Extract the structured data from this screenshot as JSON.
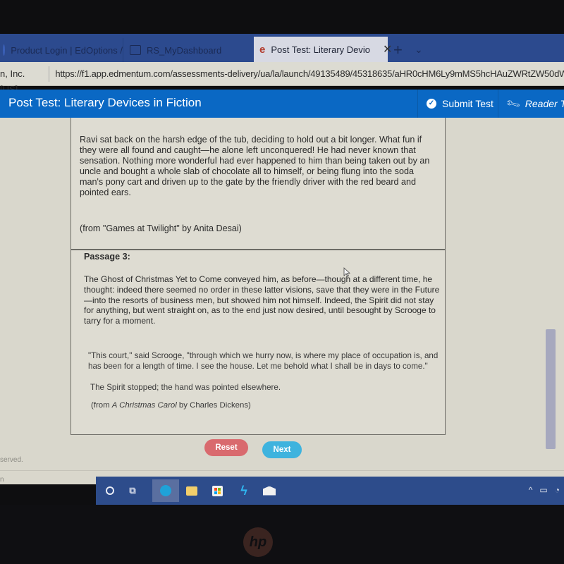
{
  "browser": {
    "tabs": [
      {
        "label": "Product Login | EdOptions /",
        "icon": "globe-icon",
        "active": false
      },
      {
        "label": "RS_MyDashboard",
        "icon": "page-icon",
        "active": false
      },
      {
        "label": "Post Test: Literary Devio",
        "icon": "edge-icon",
        "active": true
      }
    ],
    "close_glyph": "✕",
    "new_tab_glyph": "+",
    "tab_list_glyph": "⌄",
    "cert_label": "n, Inc. [US]",
    "url": "https://f1.app.edmentum.com/assessments-delivery/ua/la/launch/49135489/45318635/aHR0cHM6Ly9mMS5hcHAuZWRtZW50dW0uY2"
  },
  "header": {
    "title": "Post Test: Literary Devices in Fiction",
    "submit_label": "Submit Test",
    "reader_label": "Reader T",
    "colors": {
      "bar": "#0a68c4"
    }
  },
  "passage2": {
    "text": "Ravi sat back on the harsh edge of the tub, deciding to hold out a bit longer. What fun if they were all found and caught—he alone left unconquered! He had never known that sensation. Nothing more wonderful had ever happened to him than being taken out by an uncle and bought a whole slab of chocolate all to himself, or being flung into the soda man's pony cart and driven up to the gate by the friendly driver with the red beard and pointed ears.",
    "citation": "(from \"Games at Twilight\" by Anita Desai)"
  },
  "passage3": {
    "label": "Passage 3:",
    "para1": "The Ghost of Christmas Yet to Come conveyed him, as before—though at a different time, he thought: indeed there seemed no order in these latter visions, save that they were in the Future—into the resorts of business men, but showed him not himself. Indeed, the Spirit did not stay for anything, but went straight on, as to the end just now desired, until besought by Scrooge to tarry for a moment.",
    "para2": "\"This court,\" said Scrooge, \"through which we hurry now, is where my place of occupation is, and has been for a length of time. I see the house. Let me behold what I shall be in days to come.\"",
    "para3": "The Spirit stopped; the hand was pointed elsewhere.",
    "citation_prefix": "(from ",
    "citation_title": "A Christmas Carol",
    "citation_suffix": " by Charles Dickens)"
  },
  "actions": {
    "reset_label": "Reset",
    "next_label": "Next",
    "colors": {
      "reset": "#d96a6e",
      "next": "#3eb3de"
    }
  },
  "footer": {
    "copyright_fragment": "served.",
    "small_fragment": "n"
  },
  "taskbar": {
    "items": [
      "cortana-icon",
      "task-view-icon",
      "edge-icon",
      "file-explorer-icon",
      "store-icon",
      "app-icon",
      "mail-icon"
    ],
    "task_view_glyph": "⧉",
    "app_glyph": "ϟ",
    "tray_chevron": "^"
  },
  "bezel": {
    "logo": "hp"
  }
}
